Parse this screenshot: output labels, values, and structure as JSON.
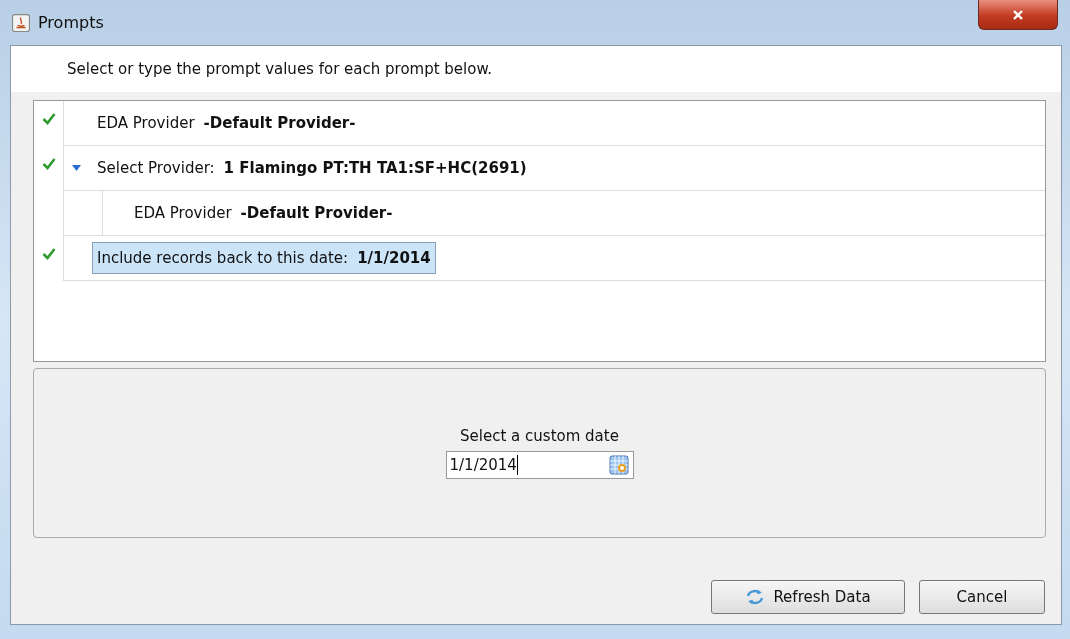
{
  "window": {
    "title": "Prompts"
  },
  "instruction": "Select or type the prompt values for each prompt below.",
  "prompts": [
    {
      "label": "EDA Provider",
      "value": "-Default Provider-",
      "checked": true,
      "selected": false
    },
    {
      "label": "Select Provider:",
      "value": "1 Flamingo PT:TH TA1:SF+HC(2691)",
      "checked": true,
      "selected": false,
      "expanded": true,
      "children": [
        {
          "label": "EDA Provider",
          "value": "-Default Provider-",
          "checked": false,
          "selected": false
        }
      ]
    },
    {
      "label": "Include records back to this date:",
      "value": "1/1/2014",
      "checked": true,
      "selected": true
    }
  ],
  "date_panel": {
    "label": "Select a custom date",
    "value": "1/1/2014"
  },
  "buttons": [
    {
      "label": "Refresh Data",
      "kind": "refresh"
    },
    {
      "label": "Cancel",
      "kind": "plain"
    }
  ]
}
